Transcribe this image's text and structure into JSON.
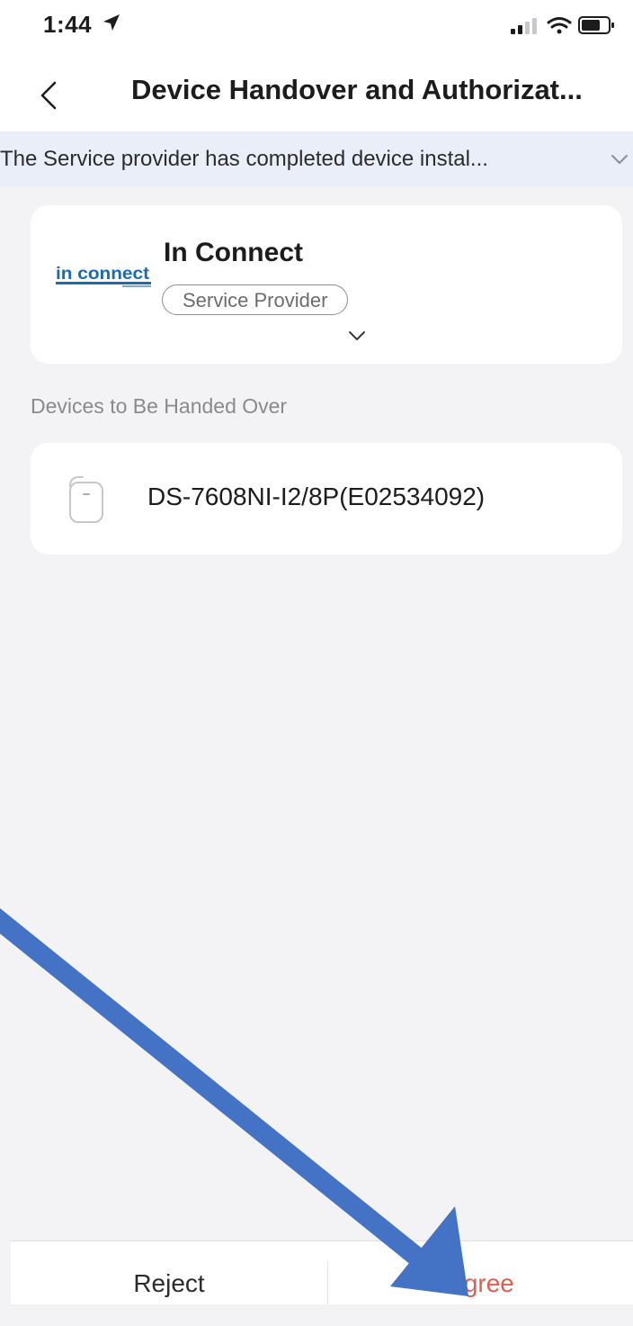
{
  "status_bar": {
    "time": "1:44",
    "location_icon": "location-arrow-icon",
    "signal_icon": "cellular-signal-icon",
    "wifi_icon": "wifi-icon",
    "battery_icon": "battery-icon"
  },
  "nav": {
    "back_icon": "chevron-left-icon",
    "title": "Device Handover and Authorizat..."
  },
  "notice": {
    "text": "The Service provider has completed device instal...",
    "expand_icon": "chevron-down-icon"
  },
  "provider": {
    "logo_text": "in connect",
    "name": "In Connect",
    "role": "Service Provider",
    "expand_icon": "chevron-down-icon"
  },
  "devices": {
    "section_label": "Devices to Be Handed Over",
    "items": [
      {
        "name": "DS-7608NI-I2/8P(E02534092)",
        "icon": "nvr-device-icon"
      }
    ]
  },
  "actions": {
    "reject_label": "Reject",
    "agree_label": "Agree"
  },
  "colors": {
    "agree": "#e15d4f",
    "annotation_arrow": "#4472c4",
    "notice_background": "#e9eef8",
    "logo": "#1a6bb5"
  }
}
